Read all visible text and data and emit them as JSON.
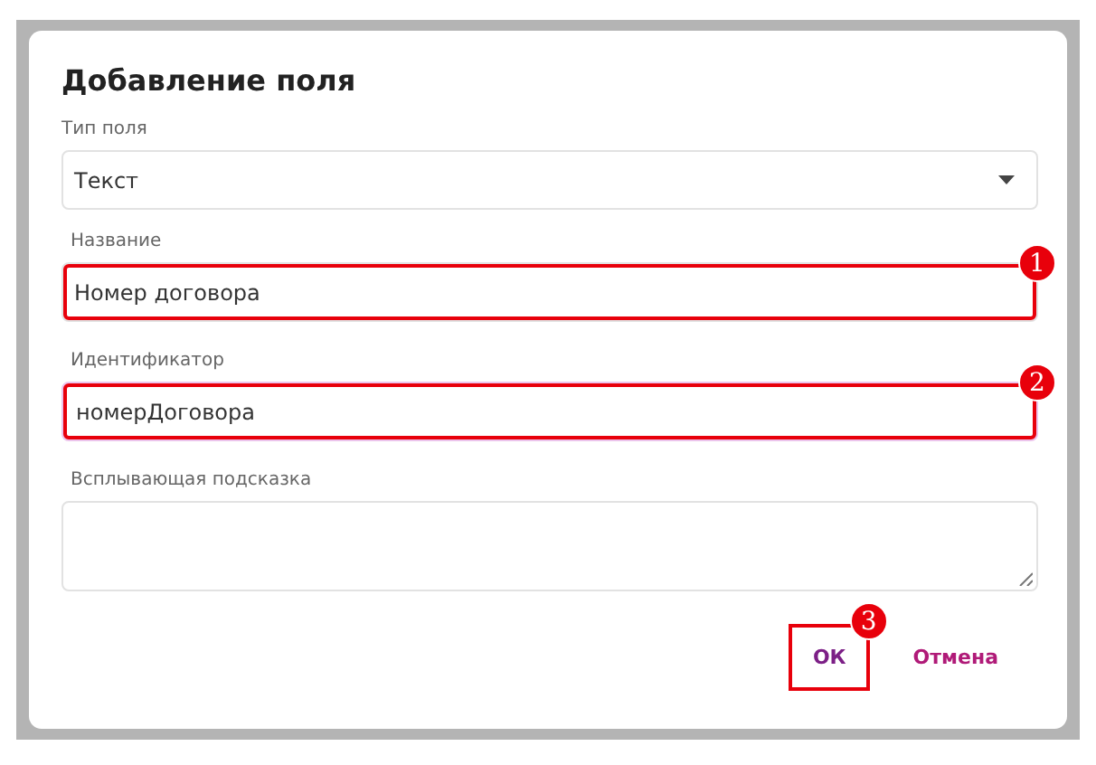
{
  "dialog": {
    "title": "Добавление поля",
    "fields": [
      {
        "kind": "select",
        "label": "Тип поля",
        "value": "Текст",
        "focused": false
      },
      {
        "kind": "text",
        "label": "Название",
        "value": "Номер договора",
        "focused": false,
        "callout": "1"
      },
      {
        "kind": "text",
        "label": "Идентификатор",
        "value": "номерДоговора",
        "focused": true,
        "callout": "2"
      },
      {
        "kind": "textarea",
        "label": "Всплывающая подсказка",
        "focused": false
      }
    ],
    "buttons": [
      {
        "label": "ОК",
        "kind": "primary",
        "callout": "3"
      },
      {
        "label": "Отмена",
        "kind": "secondary"
      }
    ]
  }
}
